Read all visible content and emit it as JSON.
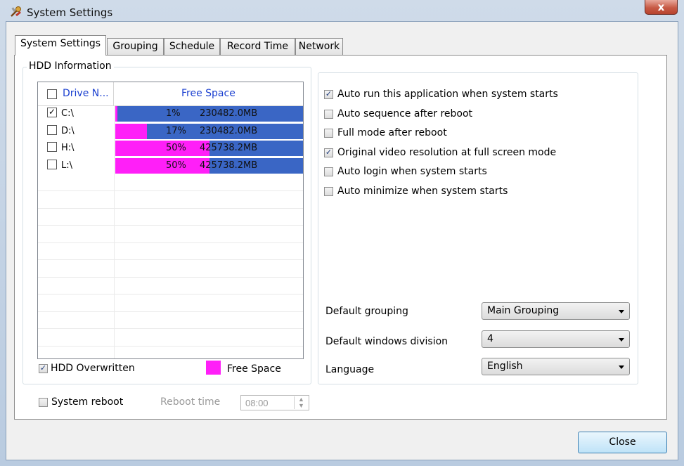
{
  "window": {
    "title": "System Settings",
    "close_glyph": "x"
  },
  "tabs": [
    "System Settings",
    "Grouping",
    "Schedule",
    "Record Time",
    "Network"
  ],
  "hdd_group": {
    "legend": "HDD Information"
  },
  "drive_list": {
    "col_drive": "Drive N...",
    "col_free": "Free Space",
    "rows": [
      {
        "checked": true,
        "drive": "C:\\",
        "percent": "1%",
        "free": "230482.0MB",
        "fraction": 0.01
      },
      {
        "checked": false,
        "drive": "D:\\",
        "percent": "17%",
        "free": "230482.0MB",
        "fraction": 0.17
      },
      {
        "checked": false,
        "drive": "H:\\",
        "percent": "50%",
        "free": "425738.2MB",
        "fraction": 0.5
      },
      {
        "checked": false,
        "drive": "L:\\",
        "percent": "50%",
        "free": "425738.2MB",
        "fraction": 0.5
      }
    ],
    "bar_colors": {
      "used": "#3a66c5",
      "free": "#ff1ff8"
    }
  },
  "hdd_overwritten": {
    "label": "HDD Overwritten",
    "checked": true
  },
  "legend_free_space": "Free Space",
  "options": [
    {
      "label": "Auto run this application when system starts",
      "checked": true
    },
    {
      "label": "Auto sequence after reboot",
      "checked": false
    },
    {
      "label": "Full mode after reboot",
      "checked": false
    },
    {
      "label": "Original video resolution at full screen mode",
      "checked": true
    },
    {
      "label": "Auto login when system starts",
      "checked": false
    },
    {
      "label": "Auto minimize when system starts",
      "checked": false
    }
  ],
  "defaults": {
    "grouping_label": "Default grouping",
    "grouping_value": "Main Grouping",
    "division_label": "Default windows division",
    "division_value": "4",
    "language_label": "Language",
    "language_value": "English"
  },
  "system_reboot": {
    "label": "System reboot",
    "checked": false,
    "time_label": "Reboot time",
    "time_value": "08:00"
  },
  "close_button": "Close"
}
